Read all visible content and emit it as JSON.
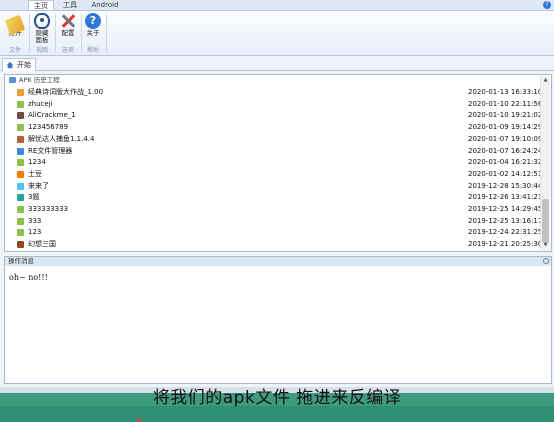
{
  "ribbon_tabs": [
    "主页",
    "工具",
    "Android"
  ],
  "ribbon": {
    "buttons": [
      {
        "label": "打开",
        "icon": "open-folder-icon"
      },
      {
        "label": "隐藏\n面板",
        "icon": "eye-icon"
      },
      {
        "label": "配置",
        "icon": "tools-icon"
      },
      {
        "label": "关于",
        "icon": "help-icon"
      }
    ],
    "groups": [
      "文件",
      "视图",
      "选项",
      "帮助"
    ]
  },
  "doc_tab": {
    "label": "开始",
    "icon": "home-icon"
  },
  "history": {
    "header": "APK 历史工程",
    "rows": [
      {
        "name": "经典诗词版大作战_1.00",
        "date": "2020-01-13 16:33:10",
        "color": "#e8a030"
      },
      {
        "name": "zhuceji",
        "date": "2020-01-10 22:11:56",
        "color": "#8bc34a"
      },
      {
        "name": "AliCrackme_1",
        "date": "2020-01-10 19:21:02",
        "color": "#6d4c41"
      },
      {
        "name": "123456789",
        "date": "2020-01-09 19:14:29",
        "color": "#8bc34a"
      },
      {
        "name": "解忧达人捕鱼1.1.4.4",
        "date": "2020-01-07 19:10:09",
        "color": "#b0603a"
      },
      {
        "name": "RE文件管理器",
        "date": "2020-01-07 16:24:24",
        "color": "#3c8dd9"
      },
      {
        "name": "1234",
        "date": "2020-01-04 16:21:32",
        "color": "#8bc34a"
      },
      {
        "name": "土豆",
        "date": "2020-01-02 14:12:51",
        "color": "#f57c00"
      },
      {
        "name": "来来了",
        "date": "2019-12-28 15:30:44",
        "color": "#4fc3f7"
      },
      {
        "name": "3题",
        "date": "2019-12-26 13:41:21",
        "color": "#26a69a"
      },
      {
        "name": "333333333",
        "date": "2019-12-25 14:29:45",
        "color": "#8bc34a"
      },
      {
        "name": "333",
        "date": "2019-12-25 13:16:17",
        "color": "#8bc34a"
      },
      {
        "name": "123",
        "date": "2019-12-24 22:31:25",
        "color": "#8bc34a"
      },
      {
        "name": "幻想三国",
        "date": "2019-12-21 20:25:30",
        "color": "#8d4a20"
      }
    ]
  },
  "log": {
    "header": "操作消息",
    "text": "oh~ no!!!"
  },
  "subtitle": "将我们的apk文件 拖进来反编译"
}
